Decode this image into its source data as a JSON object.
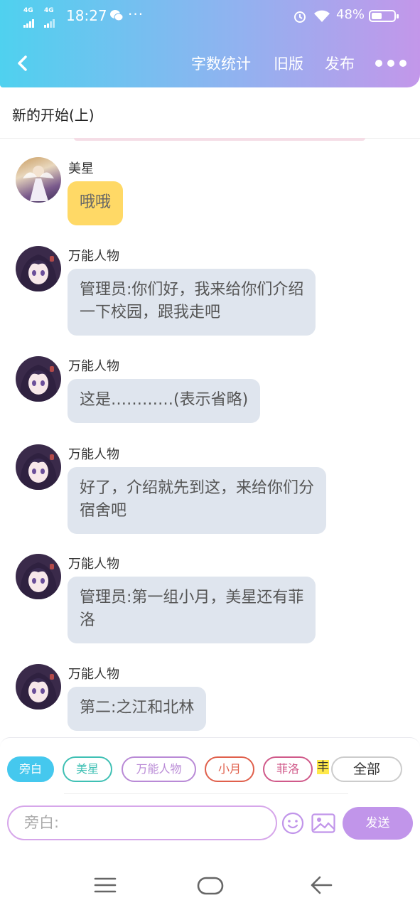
{
  "status_bar": {
    "signal_1": "4G",
    "signal_2": "4G",
    "time": "18:27",
    "more": "···",
    "battery_percent": "48%",
    "battery_level": 0.48
  },
  "nav": {
    "word_count": "字数统计",
    "old_version": "旧版",
    "publish": "发布"
  },
  "chapter_title": "新的开始(上)",
  "messages": [
    {
      "name": "美星",
      "text": "哦哦"
    },
    {
      "name": "万能人物",
      "text": "管理员:你们好，我来给你们介绍\n一下校园，跟我走吧"
    },
    {
      "name": "万能人物",
      "text": "这是…………(表示省略)"
    },
    {
      "name": "万能人物",
      "text": "好了，介绍就先到这，来给你们分\n宿舍吧"
    },
    {
      "name": "万能人物",
      "text": "管理员:第一组小月，美星还有菲\n洛"
    },
    {
      "name": "万能人物",
      "text": "第二:之江和北林"
    }
  ],
  "chips": [
    {
      "label": "旁白",
      "color": "#45c8ee"
    },
    {
      "label": "美星",
      "color": "#3fc0b4"
    },
    {
      "label": "万能人物",
      "color": "#b98ad6"
    },
    {
      "label": "小月",
      "color": "#e0604c"
    },
    {
      "label": "菲洛",
      "color": "#d05a8a"
    },
    {
      "label": "全部",
      "color": "#cccccc"
    }
  ],
  "chip_overflow": "丰",
  "input": {
    "placeholder": "旁白:"
  },
  "send_label": "发送",
  "colors": {
    "accent_blue": "#45c8ee",
    "accent_purple": "#c195ea",
    "bubble": "#dfe5ee",
    "bubble_self": "#ffd966"
  }
}
